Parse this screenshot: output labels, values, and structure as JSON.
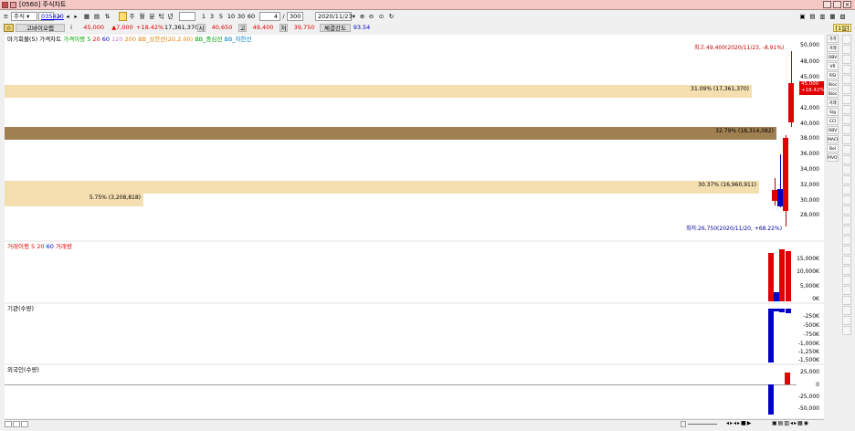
{
  "window": {
    "title": "[0560] 주식차트"
  },
  "toolbar": {
    "market": "주식",
    "code": "035420",
    "period_buttons": [
      "주",
      "월",
      "분",
      "틱",
      "년"
    ],
    "interval_buttons": [
      "1",
      "3",
      "5",
      "10",
      "30",
      "60"
    ],
    "count": "4",
    "max_count": "300",
    "date": "2020/11/23"
  },
  "info": {
    "name": "고바이오랩",
    "price": "45,000",
    "change": "▲7,000",
    "change_pct": "+18.42%",
    "volume": "17,361,370",
    "open_label": "시",
    "open": "40,650",
    "high_label": "고",
    "high": "49,400",
    "low_label": "저",
    "low": "39,750",
    "strength_label": "체결강도",
    "strength": "93.54",
    "page_indicator": "[1일]"
  },
  "main_legend": [
    "마기회불(5)",
    "가격차트",
    "가격이평 5",
    "20",
    "60",
    "120",
    "200",
    "BB_상한선(20,2.00)",
    "BB_중심선",
    "BB_하한선"
  ],
  "main_axis": [
    "50,000",
    "48,000",
    "45,000",
    "44,000",
    "42,000",
    "40,000",
    "38,000",
    "36,000",
    "34,000",
    "32,000",
    "30,000",
    "28,000"
  ],
  "price_badge": [
    "45,000",
    "+18.42%"
  ],
  "annotations": {
    "high": "최고:49,400(2020/11/23, -8.91%)",
    "low": "최저:26,750(2020/11/20, +68.22%)"
  },
  "volume_profile": [
    "31.09% (17,361,370)",
    "32.79% (18,314,082)",
    "30.37% (16,960,911)",
    "5.75% (3,208,818)"
  ],
  "vol_legend": [
    "거래이평 5",
    "20",
    "60",
    "거래량"
  ],
  "vol_axis": [
    "15,000K",
    "10,000K",
    "5,000K",
    "0K"
  ],
  "inst_legend": "기관(수량)",
  "inst_axis": [
    "-250K",
    "-500K",
    "-750K",
    "-1,000K",
    "-1,250K",
    "-1,500K"
  ],
  "foreign_legend": "외국인(수량)",
  "foreign_axis": [
    "25,000",
    "0",
    "-25,000",
    "-50,000"
  ],
  "side_tools": [
    "가격차트",
    "거래량",
    "OBV",
    "VR",
    "RSI",
    "Stoc",
    "Stoc",
    "거래",
    "Sig",
    "CCI",
    "OBV",
    "MACD",
    "Bol",
    "PIVOT"
  ],
  "colors": {
    "up": "#e00000",
    "down": "#0000c8",
    "band_light": "#f5deb0",
    "band_dark": "#a08050"
  }
}
